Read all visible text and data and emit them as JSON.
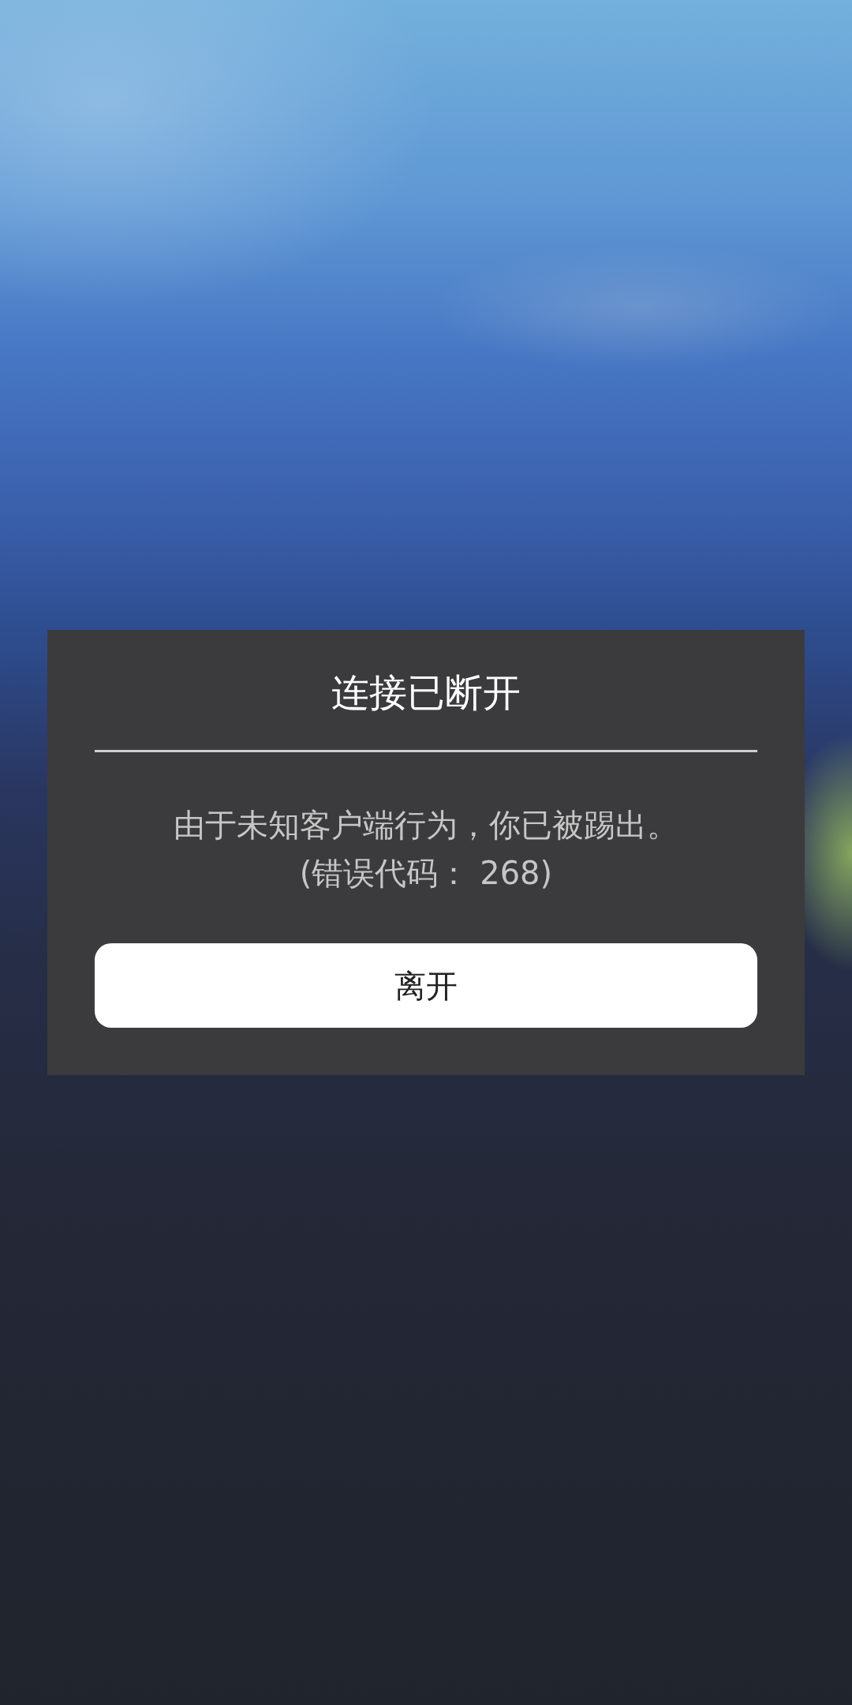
{
  "dialog": {
    "title": "连接已断开",
    "message": "由于未知客户端行为，你已被踢出。",
    "error_code": "(错误代码： 268)",
    "button": "离开"
  }
}
